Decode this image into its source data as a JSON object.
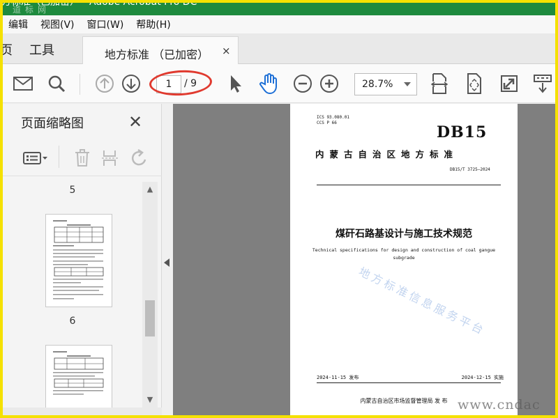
{
  "window": {
    "title": "方标准（已加密） - Adobe Acrobat Pro DC",
    "watermark": "道标网"
  },
  "menu": [
    "编辑",
    "视图(V)",
    "窗口(W)",
    "帮助(H)"
  ],
  "tabs": {
    "home_fragment": "页",
    "tools": "工具",
    "document": "地方标准 （已加密）",
    "close": "×"
  },
  "toolbar": {
    "current_page": "1",
    "total_pages": "/ 9",
    "zoom": "28.7%"
  },
  "sidepanel": {
    "title": "页面缩略图",
    "pages": [
      "5",
      "6"
    ]
  },
  "document": {
    "ics": "ICS  93.080.01",
    "ccs": "CCS  P 66",
    "code": "DB15",
    "region": "内蒙古自治区地方标准",
    "std_no": "DB15/T 3725—2024",
    "title_cn": "煤矸石路基设计与施工技术规范",
    "title_en": "Technical specifications for design and construction of coal gangue subgrade",
    "watermark": "地方标准信息服务平台",
    "published": "2024-11-15 发布",
    "implemented": "2024-12-15 实施",
    "issuer": "内蒙古自治区市场监督管理局    发 布"
  },
  "overlay": {
    "url": "www.cndac"
  },
  "colors": {
    "titlebar": "#1e8a3e",
    "frame": "#f5e100",
    "annotation": "#e03a2f"
  }
}
